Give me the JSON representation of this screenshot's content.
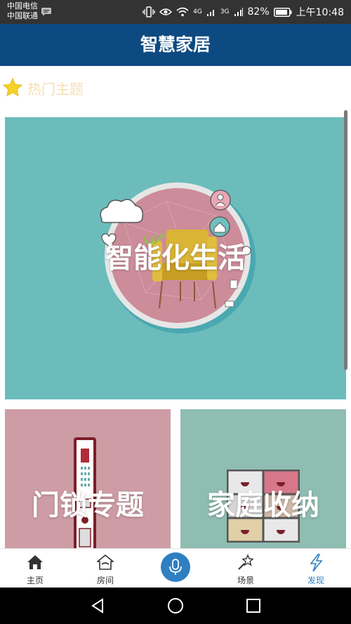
{
  "status_bar": {
    "carrier_1": "中国电信",
    "carrier_2": "中国联通",
    "network_1": "4G",
    "network_2": "3G",
    "battery": "82%",
    "time": "上午10:48"
  },
  "header": {
    "title": "智慧家居"
  },
  "section": {
    "title": "热门主题",
    "icon": "star-icon"
  },
  "cards": [
    {
      "label": "智能化生活"
    },
    {
      "label": "门锁专题"
    },
    {
      "label": "家庭收纳"
    }
  ],
  "bottom_nav": {
    "items": [
      {
        "label": "主页",
        "icon": "home-icon"
      },
      {
        "label": "房间",
        "icon": "room-icon"
      },
      {
        "label": "",
        "icon": "microphone-icon"
      },
      {
        "label": "场景",
        "icon": "magic-wand-icon"
      },
      {
        "label": "发现",
        "icon": "lightning-icon"
      }
    ],
    "active_index": 4
  },
  "colors": {
    "header": "#0d4a82",
    "accent": "#2f7fc1",
    "section_label": "#f5dfb0",
    "card_teal": "#6cbcbc",
    "card_pink": "#ce9ca5",
    "card_green": "#8fbdb1"
  }
}
